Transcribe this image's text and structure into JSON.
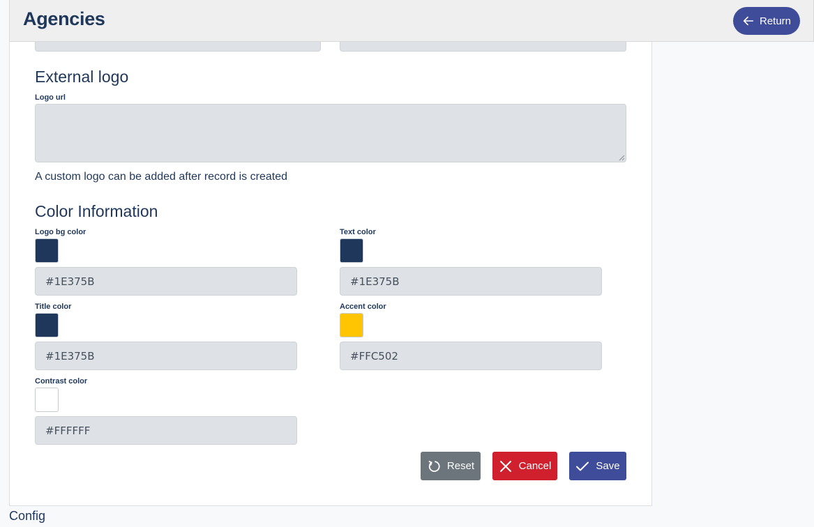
{
  "header": {
    "title": "Agencies",
    "return_label": "Return"
  },
  "external_logo": {
    "title": "External logo",
    "logo_url_label": "Logo url",
    "logo_url_value": "",
    "help_text": "A custom logo can be added after record is created"
  },
  "color_info": {
    "title": "Color Information",
    "fields": {
      "logo_bg": {
        "label": "Logo bg color",
        "value": "#1E375B",
        "color": "#1E375B"
      },
      "text": {
        "label": "Text color",
        "value": "#1E375B",
        "color": "#1E375B"
      },
      "title": {
        "label": "Title color",
        "value": "#1E375B",
        "color": "#1E375B"
      },
      "accent": {
        "label": "Accent color",
        "value": "#FFC502",
        "color": "#FFC502"
      },
      "contrast": {
        "label": "Contrast color",
        "value": "#FFFFFF",
        "color": "#FFFFFF"
      }
    }
  },
  "actions": {
    "reset_label": "Reset",
    "cancel_label": "Cancel",
    "save_label": "Save"
  },
  "footer": {
    "text": "Config"
  },
  "theme": {
    "primary": "#3E4C9A",
    "danger": "#D0202E",
    "secondary": "#6C747C",
    "text": "#1E375B"
  }
}
